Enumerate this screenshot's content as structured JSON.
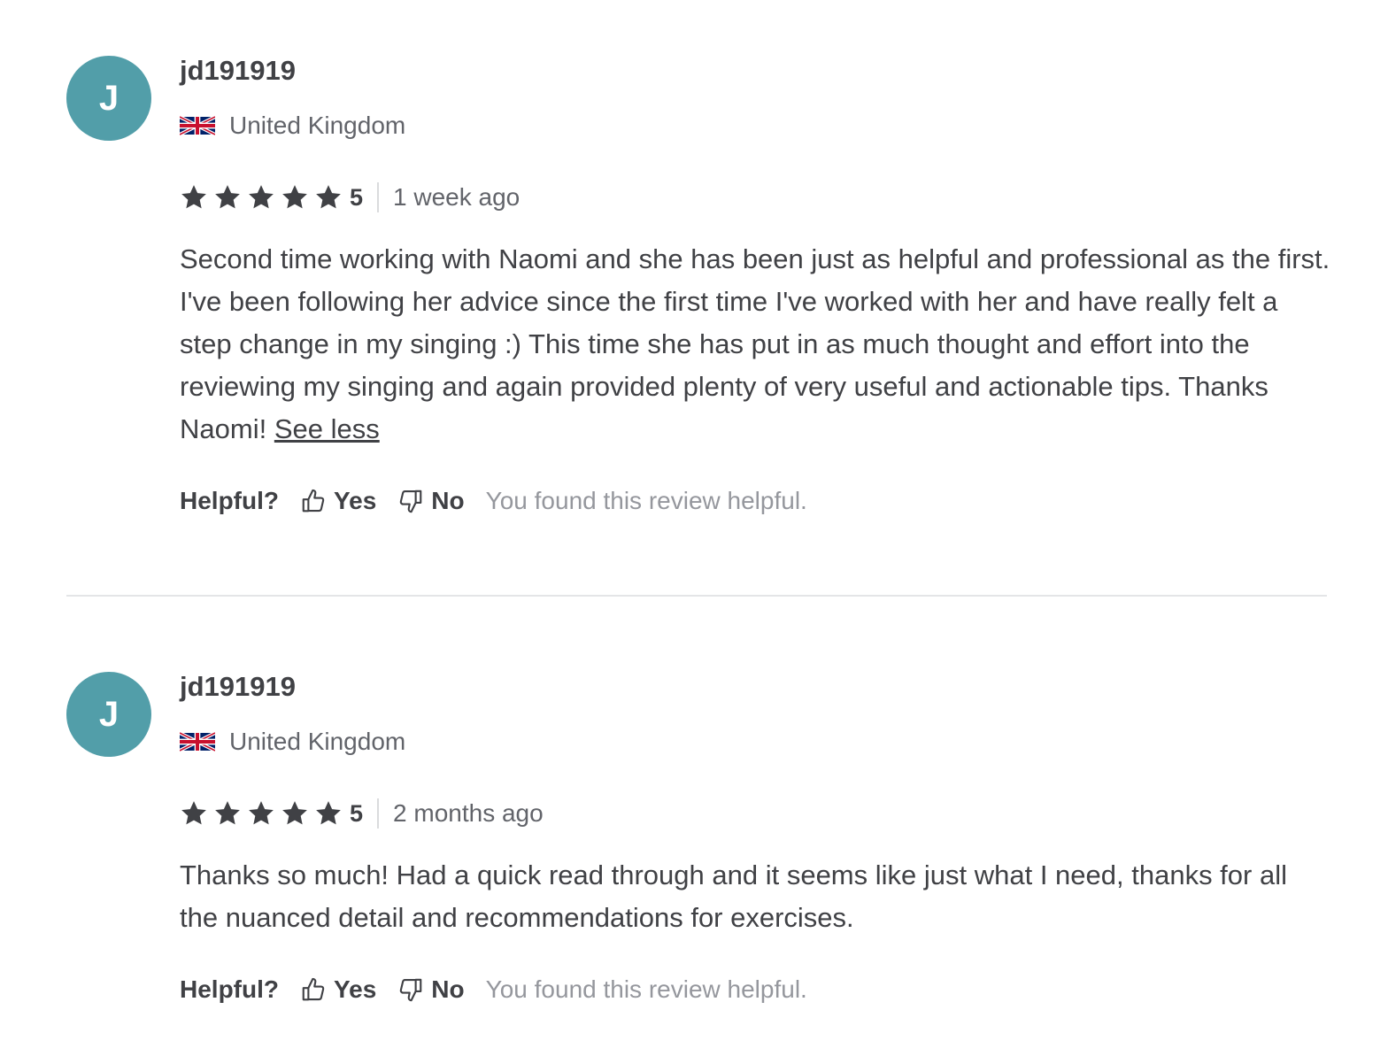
{
  "colors": {
    "avatar_bg": "#529ea9",
    "text_primary": "#404145",
    "text_secondary": "#62646a",
    "text_muted": "#95979d",
    "divider": "#e4e5e7"
  },
  "reviews": [
    {
      "avatar_letter": "J",
      "username": "jd191919",
      "country_flag_icon": "uk-flag-icon",
      "country": "United Kingdom",
      "stars": 5,
      "rating_value": "5",
      "time_ago": "1 week ago",
      "text": "Second time working with Naomi and she has been just as helpful and professional as the first. I've been following her advice since the first time I've worked with her and have really felt a step change in my singing :) This time she has put in as much thought and effort into the reviewing my singing and again provided plenty of very useful and actionable tips. Thanks Naomi!",
      "toggle_label": "See less",
      "helpful_label": "Helpful?",
      "yes_label": "Yes",
      "no_label": "No",
      "feedback_note": "You found this review helpful."
    },
    {
      "avatar_letter": "J",
      "username": "jd191919",
      "country_flag_icon": "uk-flag-icon",
      "country": "United Kingdom",
      "stars": 5,
      "rating_value": "5",
      "time_ago": "2 months ago",
      "text": "Thanks so much! Had a quick read through and it seems like just what I need, thanks for all the nuanced detail and recommendations for exercises.",
      "helpful_label": "Helpful?",
      "yes_label": "Yes",
      "no_label": "No",
      "feedback_note": "You found this review helpful."
    }
  ]
}
